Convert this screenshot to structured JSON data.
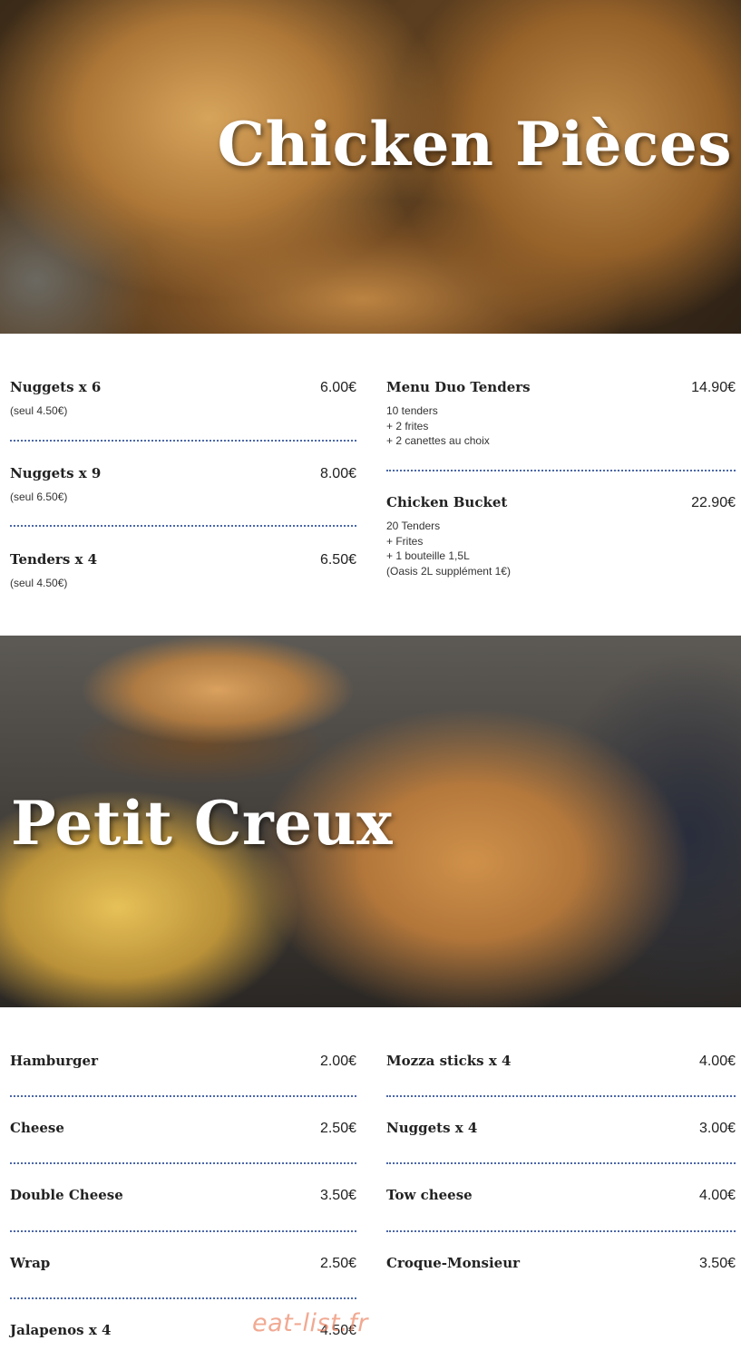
{
  "sections": [
    {
      "title": "Chicken Pièces",
      "left": [
        {
          "name": "Nuggets x 6",
          "price": "6.00€",
          "desc": [
            "(seul 4.50€)"
          ]
        },
        {
          "name": "Nuggets x 9",
          "price": "8.00€",
          "desc": [
            "(seul 6.50€)"
          ]
        },
        {
          "name": "Tenders x 4",
          "price": "6.50€",
          "desc": [
            "(seul 4.50€)"
          ]
        }
      ],
      "right": [
        {
          "name": "Menu Duo Tenders",
          "price": "14.90€",
          "desc": [
            "10 tenders",
            "+ 2 frites",
            "+ 2 canettes au choix"
          ]
        },
        {
          "name": "Chicken Bucket",
          "price": "22.90€",
          "desc": [
            "20 Tenders",
            "+ Frites",
            "+ 1 bouteille 1,5L",
            "(Oasis 2L supplément 1€)"
          ]
        }
      ]
    },
    {
      "title": "Petit Creux",
      "left": [
        {
          "name": "Hamburger",
          "price": "2.00€"
        },
        {
          "name": "Cheese",
          "price": "2.50€"
        },
        {
          "name": "Double Cheese",
          "price": "3.50€"
        },
        {
          "name": "Wrap",
          "price": "2.50€"
        },
        {
          "name": "Jalapenos x 4",
          "price": "4.50€"
        }
      ],
      "right": [
        {
          "name": "Mozza sticks x 4",
          "price": "4.00€"
        },
        {
          "name": "Nuggets x 4",
          "price": "3.00€"
        },
        {
          "name": "Tow cheese",
          "price": "4.00€"
        },
        {
          "name": "Croque-Monsieur",
          "price": "3.50€"
        }
      ]
    }
  ],
  "watermark": "eat-list.fr"
}
